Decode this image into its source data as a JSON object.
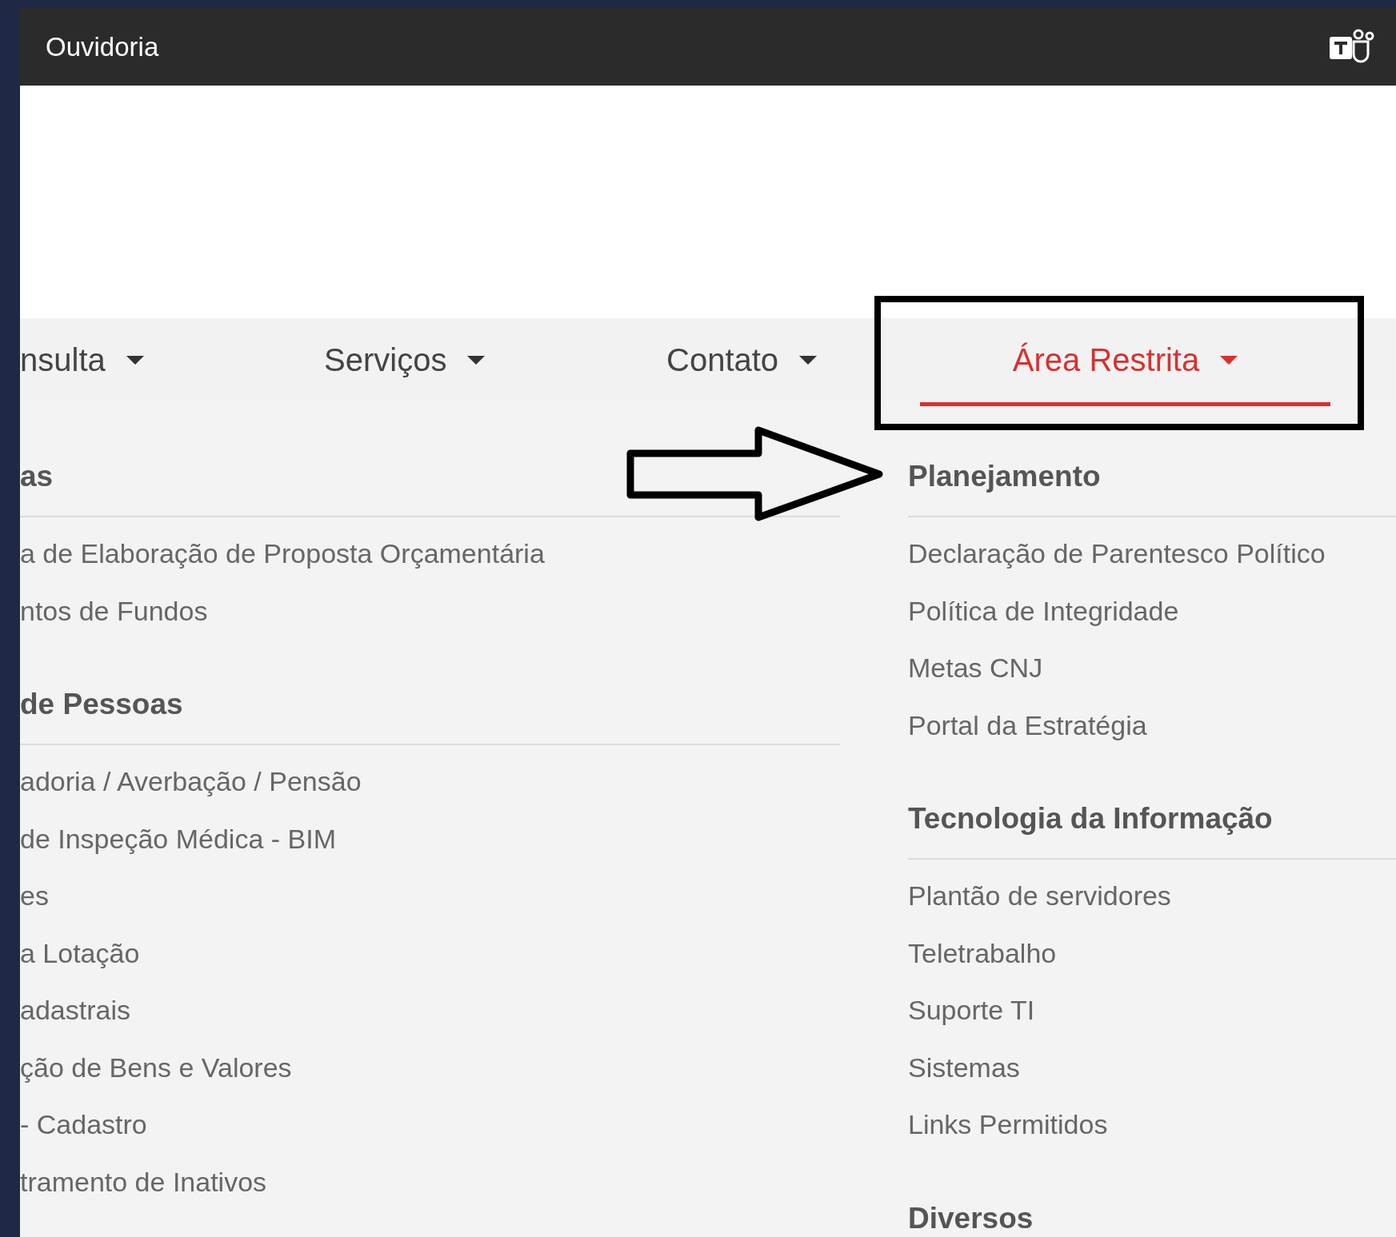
{
  "top_bar": {
    "title": "Ouvidoria"
  },
  "nav": [
    {
      "label": "nsulta",
      "selected": false
    },
    {
      "label": "Serviços",
      "selected": false
    },
    {
      "label": "Contato",
      "selected": false
    },
    {
      "label": "Área Restrita",
      "selected": true
    }
  ],
  "menu": {
    "columns": [
      {
        "sections": [
          {
            "heading": "as",
            "items": [
              "a de Elaboração de Proposta Orçamentária",
              "ntos de Fundos"
            ]
          },
          {
            "heading": "de Pessoas",
            "items": [
              "adoria / Averbação / Pensão",
              "de Inspeção Médica - BIM",
              "es",
              "a Lotação",
              "adastrais",
              "ção de Bens e Valores",
              "- Cadastro",
              "tramento de Inativos"
            ]
          }
        ]
      },
      {
        "sections": [
          {
            "heading": "Planejamento",
            "items": [
              "Declaração de Parentesco Político",
              "Política de Integridade",
              "Metas CNJ",
              "Portal da Estratégia"
            ]
          },
          {
            "heading": "Tecnologia da Informação",
            "items": [
              "Plantão de servidores",
              "Teletrabalho",
              "Suporte TI",
              "Sistemas",
              "Links Permitidos"
            ]
          },
          {
            "heading": "Diversos"
          }
        ]
      }
    ]
  }
}
